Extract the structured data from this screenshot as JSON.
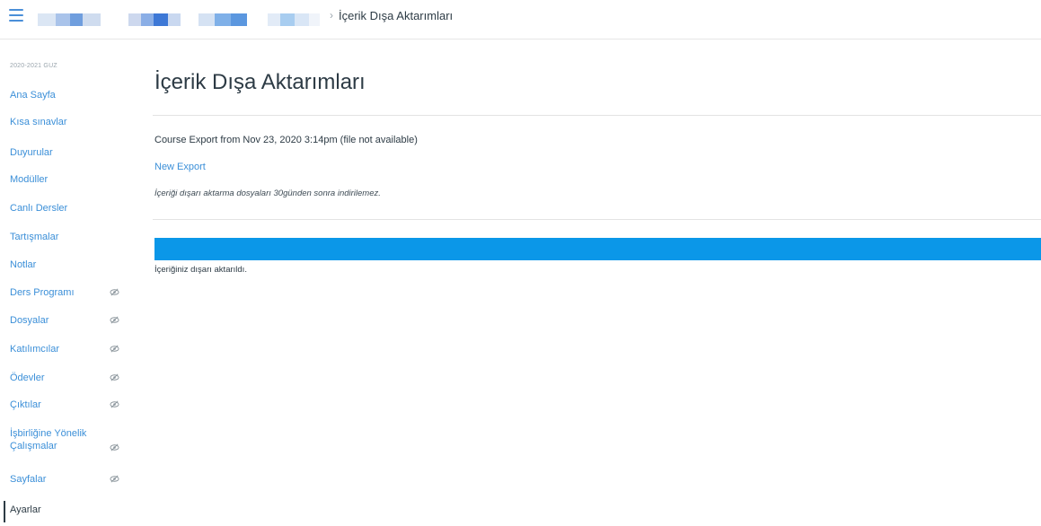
{
  "header": {
    "breadcrumb_current": "İçerik Dışa Aktarımları",
    "breadcrumb_separator": "›",
    "accent_color": "#3b8fd8"
  },
  "sidebar": {
    "term": "2020-2021 GUZ",
    "items": [
      {
        "label": "Ana Sayfa",
        "hidden": false
      },
      {
        "label": "Kısa sınavlar",
        "hidden": false
      },
      {
        "label": "Duyurular",
        "hidden": false
      },
      {
        "label": "Modüller",
        "hidden": false
      },
      {
        "label": "Canlı Dersler",
        "hidden": false
      },
      {
        "label": "Tartışmalar",
        "hidden": false
      },
      {
        "label": "Notlar",
        "hidden": false
      },
      {
        "label": "Ders Programı",
        "hidden": true
      },
      {
        "label": "Dosyalar",
        "hidden": true
      },
      {
        "label": "Katılımcılar",
        "hidden": true
      },
      {
        "label": "Ödevler",
        "hidden": true
      },
      {
        "label": "Çıktılar",
        "hidden": true
      },
      {
        "label": "İşbirliğine Yönelik Çalışmalar",
        "hidden": true
      },
      {
        "label": "Sayfalar",
        "hidden": true
      },
      {
        "label": "Ayarlar",
        "hidden": false,
        "active": true
      }
    ],
    "hidden_icon": "eye-slash-icon"
  },
  "main": {
    "title": "İçerik Dışa Aktarımları",
    "export_entry": "Course Export from Nov 23, 2020 3:14pm (file not available)",
    "new_export_label": "New Export",
    "note": "İçeriği dışarı aktarma dosyaları 30günden sonra indirilemez.",
    "progress_percent": 100,
    "progress_color": "#0b97e8",
    "done_message": "İçeriğiniz dışarı aktarıldı."
  }
}
